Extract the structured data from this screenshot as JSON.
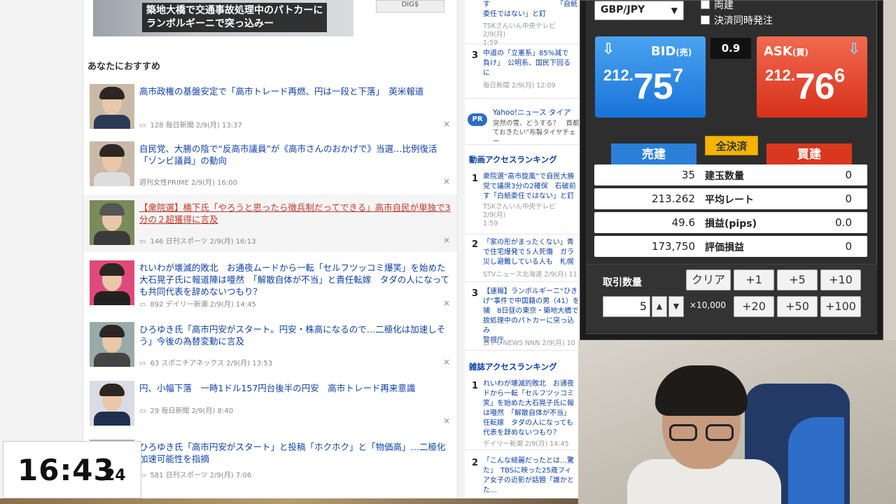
{
  "hero": {
    "caption_line1": "築地大橋で交通事故処理中のパトカーに",
    "caption_line2": "ランボルギーニで突っ込みー",
    "logo": "DIG$"
  },
  "recommend": {
    "heading": "あなたにおすすめ",
    "articles": [
      {
        "title": "高市政権の基盤安定で「高市トレード再燃、円は一段と下落」　英米報道",
        "comments": "128",
        "source": "毎日新聞",
        "date": "2/9(月) 13:37",
        "close": "×"
      },
      {
        "title": "自民党、大勝の陰で“反高市議員”が《高市さんのおかげで》当選…比例復活「ゾンビ議員」の動向",
        "comments": "",
        "source": "週刊女性PRIME",
        "date": "2/9(月) 16:00",
        "close": "×"
      },
      {
        "title": "【衆院選】橋下氏「やろうと思ったら徴兵制だってできる」高市自民が単独で3分の２超獲得に言及",
        "comments": "146",
        "source": "日刊スポーツ",
        "date": "2/9(月) 16:13",
        "close": "×"
      },
      {
        "title": "れいわが壊滅的敗北　お通夜ムードから一転「セルフツッコミ爆笑」を始めた大石晃子氏に報道陣は唖然　「解散自体が不当」と責任転嫁　タダの人になっても共同代表を辞めないつもり？",
        "comments": "892",
        "source": "デイリー新潮",
        "date": "2/9(月) 14:45",
        "close": "×"
      },
      {
        "title": "ひろゆき氏「高市円安がスタート。円安・株高になるので…二極化は加速しそう」今後の為替変動に言及",
        "comments": "63",
        "source": "スポニチアネックス",
        "date": "2/9(月) 13:53",
        "close": "×"
      },
      {
        "title": "円、小幅下落　一時1ドル157円台後半の円安　高市トレード再来意識",
        "comments": "29",
        "source": "毎日新聞",
        "date": "2/9(月) 8:40",
        "close": "×"
      },
      {
        "title": "ひろゆき氏「高市円安がスタート」と投稿「ホクホク」と「物価高」…二極化加速可能性を指摘",
        "comments": "581",
        "source": "日刊スポーツ",
        "date": "2/9(月) 7:06",
        "close": ""
      }
    ]
  },
  "ranking": {
    "top_partial": {
      "title": "す　　　　　　　　　　「自紙委任ではない」と釘",
      "meta": "TSKさんいん中央テレビ 2/9(月)\n1:59"
    },
    "item3": {
      "num": "3",
      "title": "中道の「立憲系」85%減で\n負け」　公明系、国民下回る\nに",
      "meta": "毎日新聞 2/9(月) 12:09"
    },
    "pr": {
      "badge": "PR",
      "title": "Yahoo!ニュース タイア",
      "desc": "突然の雪、どうする？　首都\nておきたい“布製タイヤチェー"
    },
    "video_heading": "動画アクセスランキング",
    "video_items": [
      {
        "num": "1",
        "title": "衆院選“高市旋風”で自民大勝\n党で議席3分の2確保　石破前\nす「白紙委任ではない」と釘",
        "meta": "TSKさんいん中央テレビ 2/9(月)\n1:59"
      },
      {
        "num": "2",
        "title": "「家の形がまったくない」青\nで住宅爆発で５人死傷　ガラ\n災し避難している人も　札幌",
        "meta": "STVニュース北海道 2/9(月) 11"
      },
      {
        "num": "3",
        "title": "【速報】ランボルギーニ“ひき\nげ”事件で中国籍の男（41）を\n捕　8日昼の東京・築地大橋で\n故処理中のパトカーに突っ込み\n警視庁",
        "meta": "日テレNEWS NNN 2/9(月) 10"
      }
    ],
    "magazine_heading": "雑誌アクセスランキング",
    "magazine_items": [
      {
        "num": "1",
        "title": "れいわが壊滅的敗北　お通夜\nドから一転「セルフツッコミ\n笑」を始めた大石晃子氏に報\nは唖然　「解散自体が不当」\n任転嫁　タダの人になっても\n代表を辞めないつもり？",
        "meta": "デイリー新潮 2/9(月) 14:45"
      },
      {
        "num": "2",
        "title": "「こんな綺麗だったとは…驚\nた」　TBSに映った25歳フィ\nア女子の近影が話題「誰かと\nた…",
        "meta": ""
      }
    ]
  },
  "trade": {
    "pair": "GBP/JPY",
    "check_both": "両建",
    "check_settle": "決済同時発注",
    "spread": "0.9",
    "bid": {
      "label": "BID",
      "label_small": "(売)",
      "int": "212.",
      "main": "75",
      "pip": "7"
    },
    "ask": {
      "label": "ASK",
      "label_small": "(買)",
      "int": "212.",
      "main": "76",
      "pip": "6"
    },
    "sell_label": "売建",
    "buy_label": "買建",
    "close_all": "全決済",
    "positions": [
      {
        "left": "35",
        "label": "建玉数量",
        "right": "0"
      },
      {
        "left": "213.262",
        "label": "平均レート",
        "right": "0"
      },
      {
        "left": "49.6",
        "label": "損益(pips)",
        "right": "0.0"
      },
      {
        "left": "173,750",
        "label": "評価損益",
        "right": "0"
      }
    ],
    "qty_label": "取引数量",
    "qty_value": "5",
    "qty_unit": "×10,000",
    "buttons": {
      "clear": "クリア",
      "p1": "+1",
      "p5": "+5",
      "p10": "+10",
      "p20": "+20",
      "p50": "+50",
      "p100": "+100"
    },
    "colors": {
      "bid": "#1873d8",
      "ask": "#d7301a",
      "close_all": "#f4b400"
    }
  },
  "clock": {
    "hm": "16:43",
    "s": "24"
  }
}
